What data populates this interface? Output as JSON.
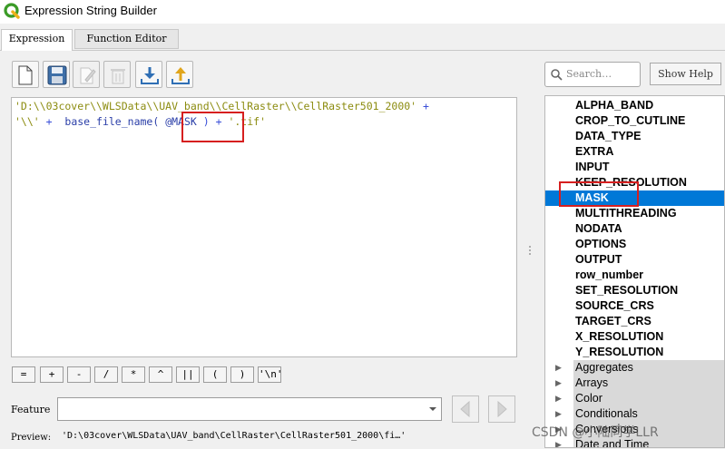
{
  "window": {
    "title": "Expression String Builder"
  },
  "tabs": [
    {
      "label": "Expression",
      "active": true
    },
    {
      "label": "Function Editor",
      "active": false
    }
  ],
  "toolbar": [
    {
      "icon": "new-file-icon"
    },
    {
      "icon": "save-icon"
    },
    {
      "icon": "edit-icon",
      "disabled": true
    },
    {
      "icon": "delete-icon",
      "disabled": true
    },
    {
      "icon": "import-icon"
    },
    {
      "icon": "export-icon"
    }
  ],
  "editor": {
    "line1_str1": "'D:\\\\03cover\\\\WLSData\\\\UAV_band\\\\CellRaster\\\\CellRaster501_2000'",
    "line1_op": " +",
    "line2_str": "'\\\\'",
    "line2_op1": " +  ",
    "line2_fn": "base_file_name(",
    "line2_var": " @MASK ",
    "line2_close": ")",
    "line2_op2": " + ",
    "line2_str2": "'.tif'"
  },
  "operators": [
    "=",
    "+",
    "-",
    "/",
    "*",
    "^",
    "||",
    "(",
    ")",
    "'\\n'"
  ],
  "feature": {
    "label": "Feature",
    "value": ""
  },
  "preview": {
    "label": "Preview:",
    "value": "'D:\\03cover\\WLSData\\UAV_band\\CellRaster\\CellRaster501_2000\\fi…'"
  },
  "search": {
    "placeholder": "Search…"
  },
  "show_help_label": "Show Help",
  "variables": [
    "ALPHA_BAND",
    "CROP_TO_CUTLINE",
    "DATA_TYPE",
    "EXTRA",
    "INPUT",
    "KEEP_RESOLUTION",
    "MASK",
    "MULTITHREADING",
    "NODATA",
    "OPTIONS",
    "OUTPUT",
    "row_number",
    "SET_RESOLUTION",
    "SOURCE_CRS",
    "TARGET_CRS",
    "X_RESOLUTION",
    "Y_RESOLUTION"
  ],
  "selected_variable": "MASK",
  "groups": [
    "Aggregates",
    "Arrays",
    "Color",
    "Conditionals",
    "Conversions",
    "Date and Time"
  ],
  "watermark": "CSDN @小陆同学LLR",
  "colors": {
    "selection": "#0078d7",
    "highlight_box": "#d61f1f",
    "string": "#8c8c10",
    "operator": "#3a4fd8"
  }
}
